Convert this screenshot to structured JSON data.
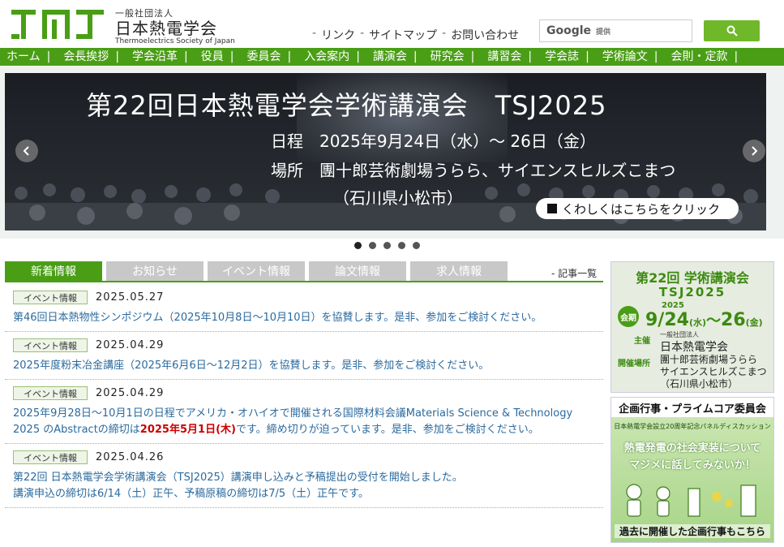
{
  "header": {
    "org_small": "一般社団法人",
    "org_name": "日本熱電学会",
    "org_en": "Thermoelectrics Society of Japan",
    "links": [
      "リンク",
      "サイトマップ",
      "お問い合わせ"
    ],
    "search_brand": "Google",
    "search_sub": "提供"
  },
  "nav": [
    "ホーム",
    "会長挨拶",
    "学会沿革",
    "役員",
    "委員会",
    "入会案内",
    "講演会",
    "研究会",
    "講習会",
    "学会誌",
    "学術論文",
    "会則・定款"
  ],
  "banner": {
    "title": "第22回日本熱電学会学術講演会　TSJ2025",
    "schedule": "日程　2025年9月24日（水）～ 26日（金）",
    "venue": "場所　團十郎芸術劇場うらら、サイエンスヒルズこまつ",
    "venue2": "（石川県小松市）",
    "cta": "くわしくはこちらをクリック"
  },
  "tabs": [
    "新着情報",
    "お知らせ",
    "イベント情報",
    "論文情報",
    "求人情報"
  ],
  "kiji_link": "記事一覧",
  "news": [
    {
      "badge": "イベント情報",
      "date": "2025.05.27",
      "text": "第46回日本熱物性シンポジウム（2025年10月8日～10月10日）を協賛します。是非、参加をご検討ください。"
    },
    {
      "badge": "イベント情報",
      "date": "2025.04.29",
      "text": "2025年度粉末冶金講座（2025年6月6日～12月2日）を協賛します。是非、参加をご検討ください。"
    },
    {
      "badge": "イベント情報",
      "date": "2025.04.29",
      "text_a": "2025年9月28日～10月1日の日程でアメリカ・オハイオで開催される国際材料会議Materials Science & Technology 2025 のAbstractの締切は",
      "text_red": "2025年5月1日(木)",
      "text_b": "です。締め切りが迫っています。是非、参加をご検討ください。"
    },
    {
      "badge": "イベント情報",
      "date": "2025.04.26",
      "text_a": "第22回 日本熱電学会学術講演会（TSJ2025）講演申し込みと予稿提出の受付を開始しました。",
      "text_b": "講演申込の締切は6/14（土）正午、予稿原稿の締切は7/5（土）正午です。"
    }
  ],
  "side1": {
    "title": "第22回 学術講演会",
    "sub": "TSJ2025",
    "period_label": "会期",
    "year": "2025",
    "date_a": "9/24",
    "dow_a": "(水)",
    "dash": "～",
    "date_b": "26",
    "dow_b": "(金)",
    "host_label": "主催",
    "host_small": "一般社団法人",
    "host_name": "日本熱電学会",
    "venue_label": "開催場所",
    "venue_a": "團十郎芸術劇場うらら",
    "venue_b": "サイエンスヒルズこまつ",
    "venue_c": "（石川県小松市）"
  },
  "side2": {
    "header": "企画行事・プライムコア委員会",
    "sub": "日本熱電学会設立20周年記念パネルディスカッション",
    "line1": "熱電発電の社会実装について",
    "line2": "マジメに話してみないか！",
    "bottom": "過去に開催した企画行事もこちら"
  },
  "colors": {
    "brand_green": "#4a9e16",
    "link_blue": "#2b6a9e",
    "accent_red": "#cc0000"
  }
}
